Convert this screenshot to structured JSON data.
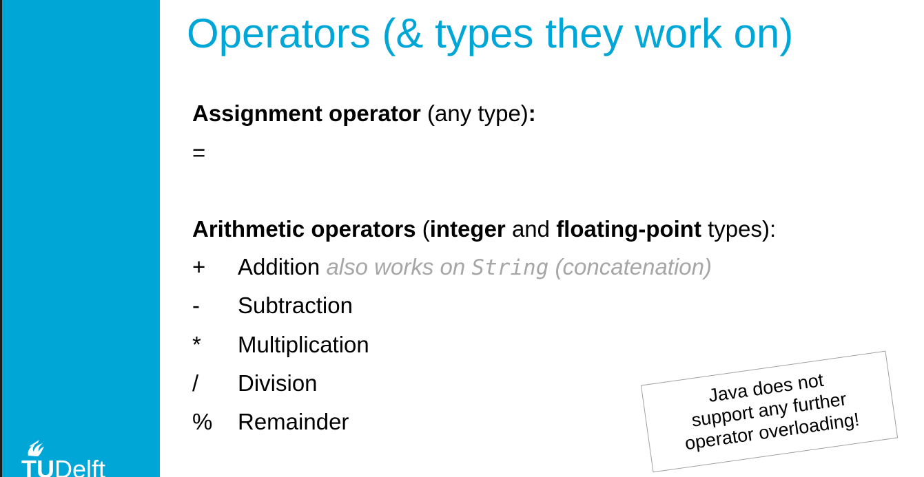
{
  "slide": {
    "title": "Operators (& types they work on)",
    "assignment": {
      "heading": "Assignment operator",
      "qualifier": " (any type)",
      "colon": ":",
      "symbol": "="
    },
    "arithmetic": {
      "heading": "Arithmetic operators",
      "open_paren": " (",
      "integer": "integer",
      "and": " and ",
      "floating_point": "floating-point",
      "types_close": " types):",
      "operators": [
        {
          "symbol": "+",
          "name": "Addition",
          "note_pre": "also works on ",
          "note_code": "String",
          "note_post": " (concatenation)"
        },
        {
          "symbol": "-",
          "name": "Subtraction"
        },
        {
          "symbol": "*",
          "name": "Multiplication"
        },
        {
          "symbol": "/",
          "name": "Division"
        },
        {
          "symbol": "%",
          "name": "Remainder"
        }
      ]
    },
    "callout": {
      "lines": [
        "Java does not",
        "support any further",
        "operator overloading!"
      ]
    }
  },
  "branding": {
    "logo_tu": "TU",
    "logo_delft": "Delft",
    "sidebar_color": "#00a6d6",
    "title_color": "#00a6d6",
    "note_color": "#a6a6a6"
  }
}
